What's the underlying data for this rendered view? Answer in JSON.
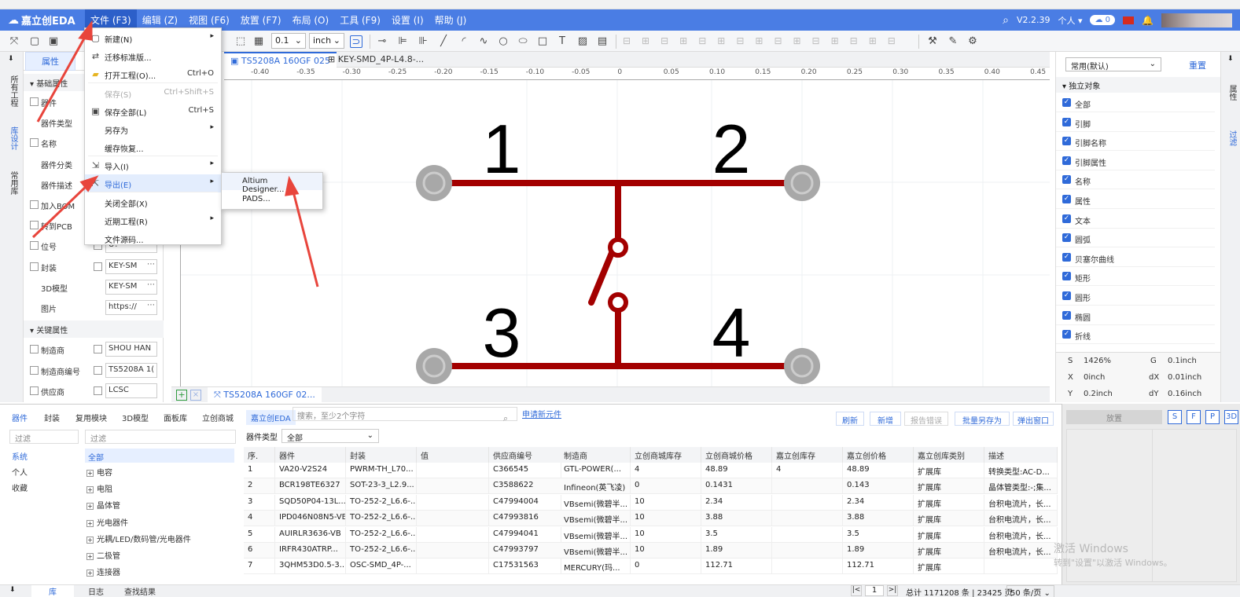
{
  "menubar": {
    "logo": "嘉立创EDA",
    "items": [
      "文件 (F3)",
      "编辑 (Z)",
      "视图 (F6)",
      "放置 (F7)",
      "布局 (O)",
      "工具 (F9)",
      "设置 (I)",
      "帮助 (J)"
    ],
    "version": "V2.2.39",
    "user": "个人",
    "cloud_count": "0"
  },
  "toolbar": {
    "grid_value": "0.1",
    "unit": "inch"
  },
  "doc_tabs": [
    "TS5208A 160GF 025",
    "KEY-SMD_4P-L4.8-..."
  ],
  "ruler_labels": [
    "-0.40",
    "-0.35",
    "-0.30",
    "-0.25",
    "-0.20",
    "-0.15",
    "-0.10",
    "-0.05",
    "0",
    "0.05",
    "0.10",
    "0.15",
    "0.20",
    "0.25",
    "0.30",
    "0.35",
    "0.40",
    "0.45"
  ],
  "file_menu": {
    "items": [
      {
        "label": "新建(N)",
        "shortcut": "",
        "submenu": true,
        "disabled": false,
        "icon": "new-icon"
      },
      {
        "label": "迁移标准版...",
        "shortcut": "",
        "submenu": false,
        "disabled": false,
        "icon": "migrate-icon"
      },
      {
        "label": "打开工程(O)...",
        "shortcut": "Ctrl+O",
        "submenu": false,
        "disabled": false,
        "icon": "folder-icon"
      },
      {
        "label": "保存(S)",
        "shortcut": "Ctrl+Shift+S",
        "submenu": false,
        "disabled": true,
        "icon": ""
      },
      {
        "label": "保存全部(L)",
        "shortcut": "Ctrl+S",
        "submenu": false,
        "disabled": false,
        "icon": "save-all-icon"
      },
      {
        "label": "另存为",
        "shortcut": "",
        "submenu": true,
        "disabled": false,
        "icon": ""
      },
      {
        "label": "缓存恢复...",
        "shortcut": "",
        "submenu": false,
        "disabled": false,
        "icon": ""
      },
      {
        "label": "导入(I)",
        "shortcut": "",
        "submenu": true,
        "disabled": false,
        "icon": "import-icon"
      },
      {
        "label": "导出(E)",
        "shortcut": "",
        "submenu": true,
        "disabled": false,
        "icon": "export-icon",
        "highlighted": true
      },
      {
        "label": "关闭全部(X)",
        "shortcut": "",
        "submenu": false,
        "disabled": false,
        "icon": ""
      },
      {
        "label": "近期工程(R)",
        "shortcut": "",
        "submenu": true,
        "disabled": false,
        "icon": ""
      },
      {
        "label": "文件源码...",
        "shortcut": "",
        "submenu": false,
        "disabled": false,
        "icon": ""
      }
    ]
  },
  "export_submenu": [
    "Altium Designer...",
    "PADS..."
  ],
  "left_strip": [
    "所有工程",
    "库设计",
    "常用库"
  ],
  "left_panel": {
    "tab": "属性",
    "section_basic": "基础属性",
    "section_key": "关键属性",
    "props": [
      {
        "label": "器件",
        "value": ""
      },
      {
        "label": "器件类型",
        "value": ""
      },
      {
        "label": "名称",
        "value": ""
      },
      {
        "label": "器件分类",
        "value": ""
      },
      {
        "label": "器件描述",
        "value": ""
      },
      {
        "label": "加入BOM",
        "value": ""
      },
      {
        "label": "转到PCB",
        "value": ""
      },
      {
        "label": "位号",
        "value": "U?"
      },
      {
        "label": "封装",
        "value": "KEY-SM"
      },
      {
        "label": "3D模型",
        "value": "KEY-SM"
      },
      {
        "label": "图片",
        "value": "https://"
      }
    ],
    "key_props": [
      {
        "label": "制造商",
        "value": "SHOU HAN"
      },
      {
        "label": "制造商编号",
        "value": "TS5208A 1("
      },
      {
        "label": "供应商",
        "value": "LCSC"
      }
    ]
  },
  "canvas": {
    "pins": [
      "1",
      "2",
      "3",
      "4"
    ],
    "bottom_tab": "TS5208A 160GF 02..."
  },
  "right_panel": {
    "preset": "常用(默认)",
    "reset": "重置",
    "group": "独立对象",
    "items": [
      "全部",
      "引脚",
      "引脚名称",
      "引脚属性",
      "名称",
      "属性",
      "文本",
      "圆弧",
      "贝塞尔曲线",
      "矩形",
      "圆形",
      "椭圆",
      "折线"
    ],
    "coords": {
      "S": "1426%",
      "G": "0.1inch",
      "X": "0inch",
      "dX": "0.01inch",
      "Y": "0.2inch",
      "dY": "0.16inch"
    },
    "right_strip": [
      "属性",
      "过滤"
    ]
  },
  "bottom": {
    "tabs": [
      "器件",
      "封装",
      "复用模块",
      "3D模型",
      "面板库",
      "立创商城",
      "嘉立创EDA"
    ],
    "search_placeholder": "搜索，至少2个字符",
    "new_link": "申请新元件",
    "buttons": [
      "刷新",
      "新增",
      "报告错误",
      "批量另存为",
      "弹出窗口"
    ],
    "filter_placeholder": "过滤",
    "lib_list": [
      "系统",
      "个人",
      "收藏"
    ],
    "cat_all": "全部",
    "categories": [
      "电容",
      "电阻",
      "晶体管",
      "光电器件",
      "光耦/LED/数码管/光电器件",
      "二极管",
      "连接器"
    ],
    "type_label": "器件类型",
    "type_value": "全部",
    "columns": [
      "序.",
      "器件",
      "封装",
      "值",
      "供应商编号",
      "制造商",
      "立创商城库存",
      "立创商城价格",
      "嘉立创库存",
      "嘉立创价格",
      "嘉立创库类别",
      "描述"
    ],
    "rows": [
      [
        "1",
        "VA20-V2S24",
        "PWRM-TH_L70...",
        "",
        "C366545",
        "GTL-POWER(...",
        "4",
        "48.89",
        "4",
        "48.89",
        "扩展库",
        "转换类型:AC-D..."
      ],
      [
        "2",
        "BCR198TE6327",
        "SOT-23-3_L2.9...",
        "",
        "C3588622",
        "Infineon(英飞凌)",
        "0",
        "0.1431",
        "",
        "0.143",
        "扩展库",
        "晶体管类型:-;集..."
      ],
      [
        "3",
        "SQD50P04-13L...",
        "TO-252-2_L6.6-...",
        "",
        "C47994004",
        "VBsemi(微碧半...",
        "10",
        "2.34",
        "",
        "2.34",
        "扩展库",
        "台积电流片，长..."
      ],
      [
        "4",
        "IPD046N08N5-VB",
        "TO-252-2_L6.6-...",
        "",
        "C47993816",
        "VBsemi(微碧半...",
        "10",
        "3.88",
        "",
        "3.88",
        "扩展库",
        "台积电流片，长..."
      ],
      [
        "5",
        "AUIRLR3636-VB",
        "TO-252-2_L6.6-...",
        "",
        "C47994041",
        "VBsemi(微碧半...",
        "10",
        "3.5",
        "",
        "3.5",
        "扩展库",
        "台积电流片，长..."
      ],
      [
        "6",
        "IRFR430ATRP...",
        "TO-252-2_L6.6-...",
        "",
        "C47993797",
        "VBsemi(微碧半...",
        "10",
        "1.89",
        "",
        "1.89",
        "扩展库",
        "台积电流片，长..."
      ],
      [
        "7",
        "3QHM53D0.5-3...",
        "OSC-SMD_4P-...",
        "",
        "C17531563",
        "MERCURY(玛...",
        "0",
        "112.71",
        "",
        "112.71",
        "扩展库",
        ""
      ]
    ]
  },
  "preview": {
    "place": "放置",
    "btns": [
      "S",
      "F",
      "P",
      "3D"
    ]
  },
  "status": {
    "tabs": [
      "库",
      "日志",
      "查找结果"
    ],
    "page": "1",
    "total": "总计 1171208 条 | 23425 页",
    "per_page": "50 条/页"
  },
  "watermark": {
    "line1": "激活 Windows",
    "line2": "转到\"设置\"以激活 Windows。"
  },
  "colors": {
    "menubar": "#4a7de4",
    "wire": "#a30000",
    "pin_pad": "#a8a8a8",
    "accent": "#2f6ad9",
    "arrow": "#e8453c"
  }
}
